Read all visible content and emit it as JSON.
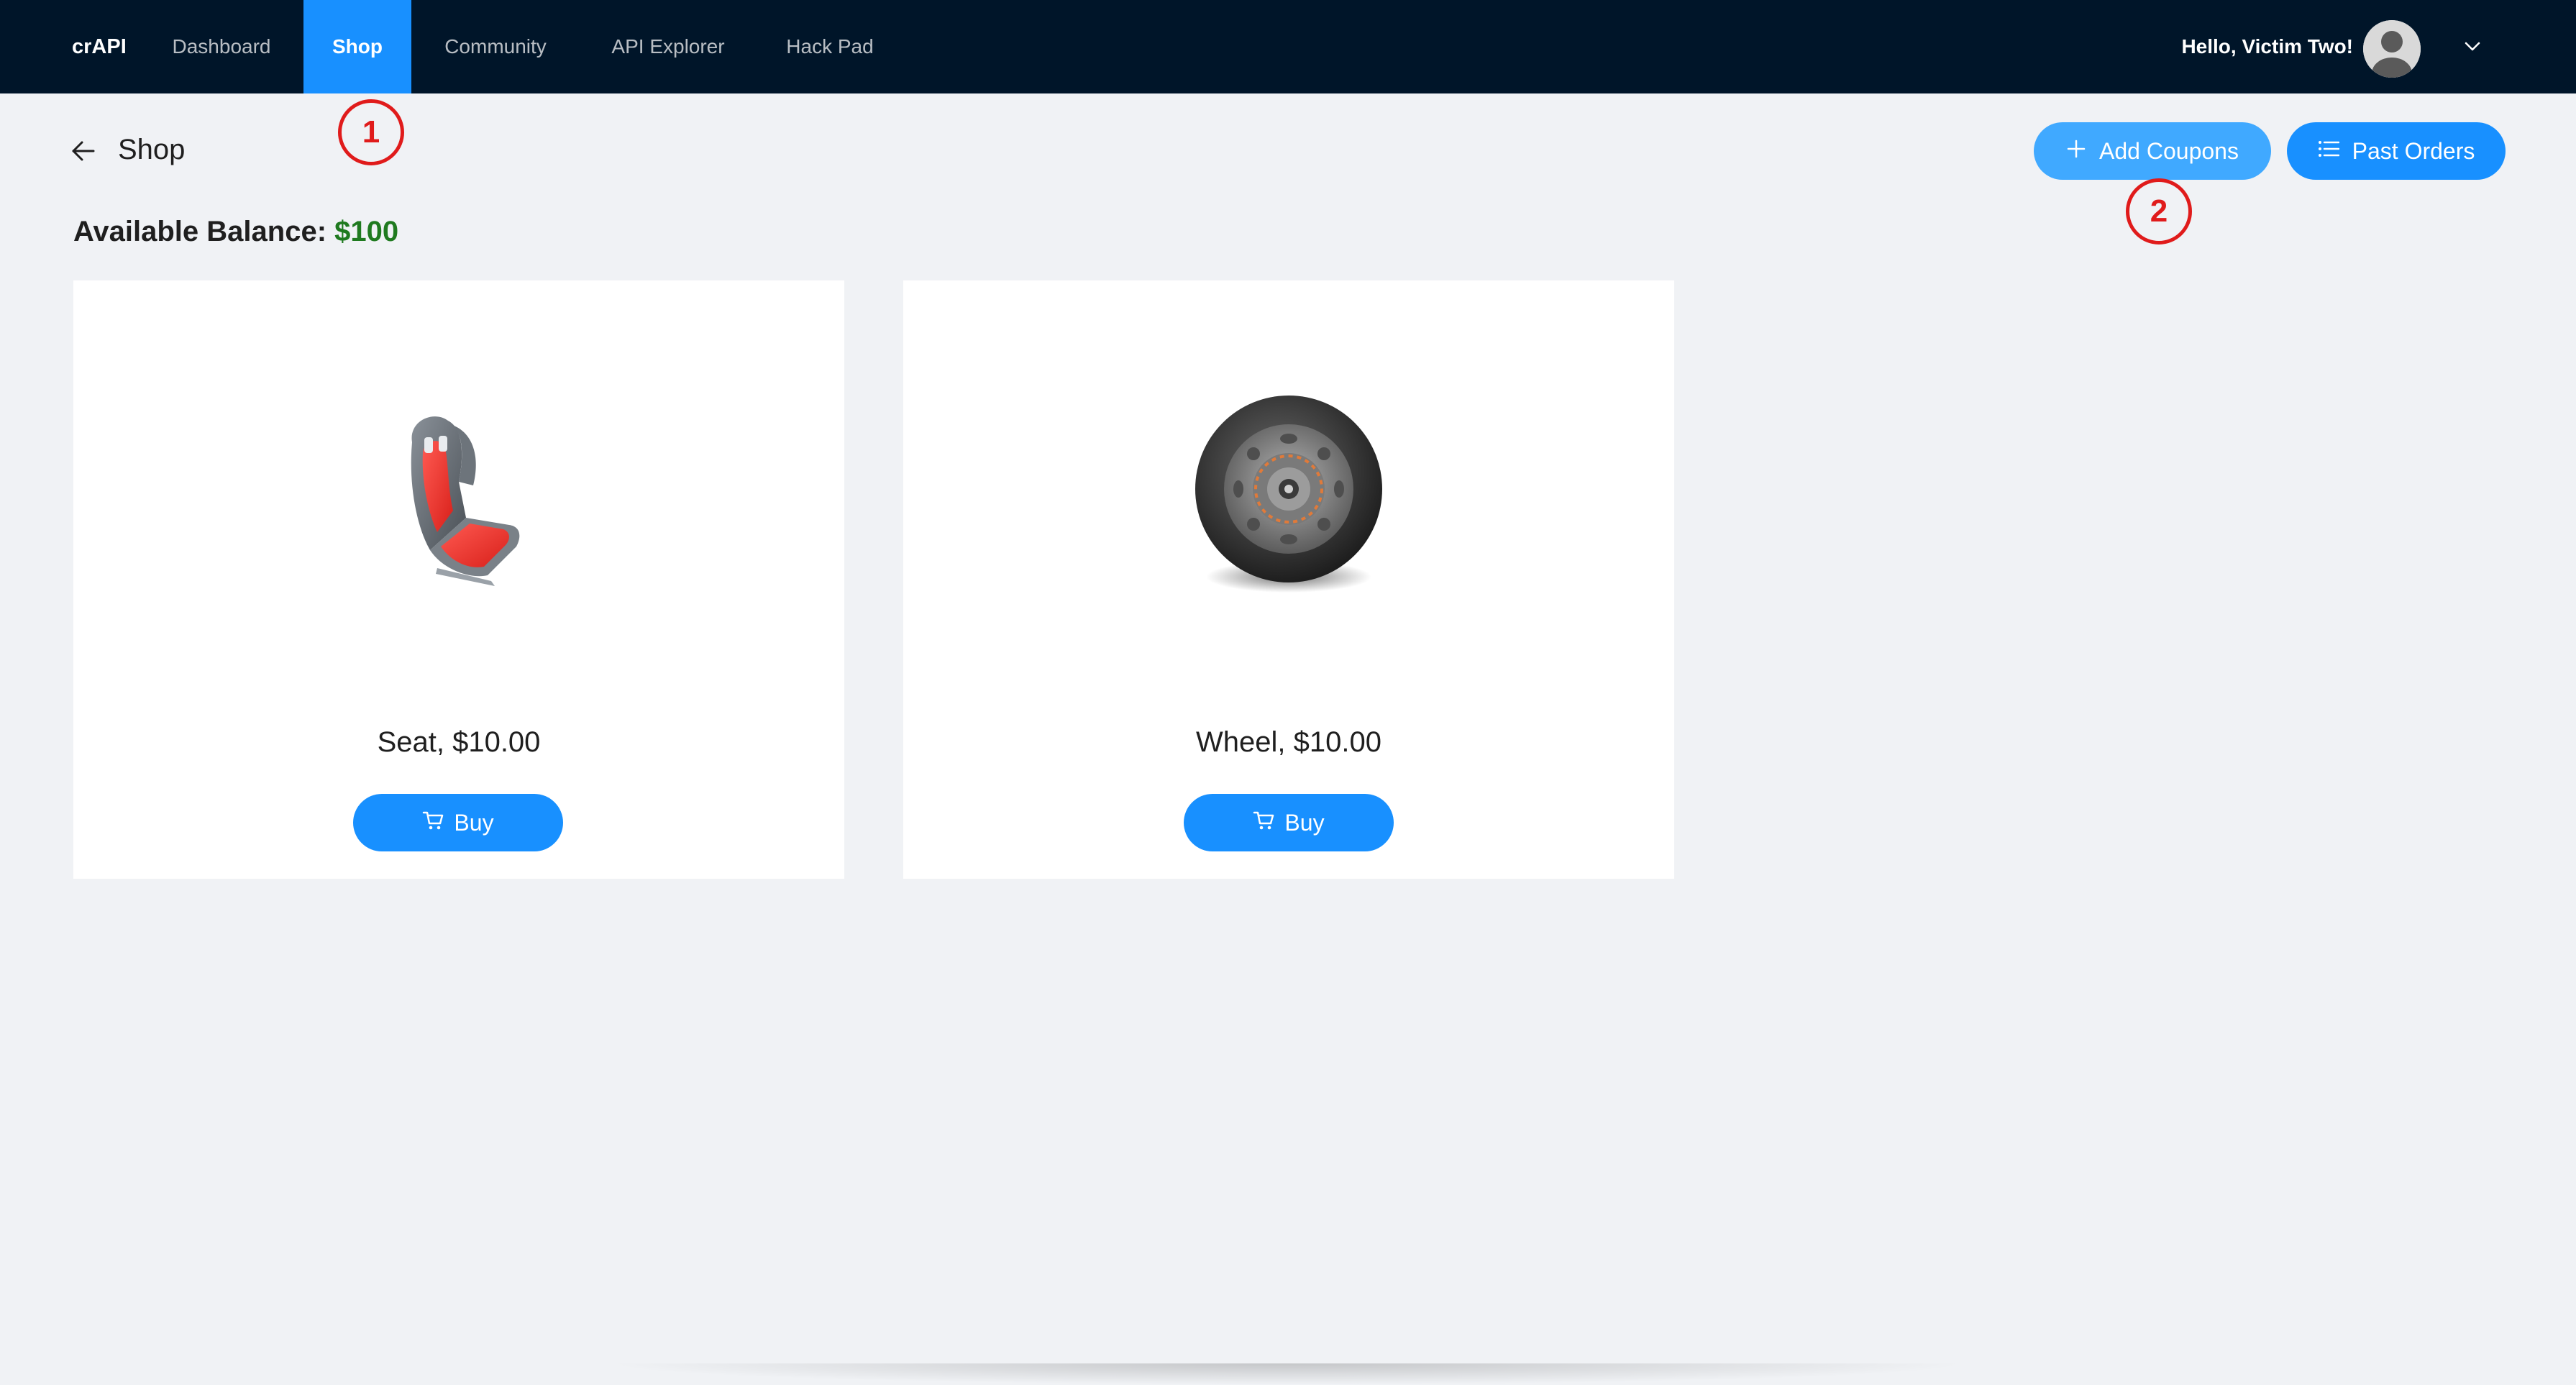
{
  "navbar": {
    "brand": "crAPI",
    "items": [
      {
        "label": "Dashboard"
      },
      {
        "label": "Shop"
      },
      {
        "label": "Community"
      },
      {
        "label": "API Explorer"
      },
      {
        "label": "Hack Pad"
      }
    ],
    "active_item": "Shop",
    "greeting": "Hello, Victim Two!",
    "background_color": "#001529",
    "active_color": "#1890ff"
  },
  "page": {
    "title": "Shop",
    "balance_label": "Available Balance",
    "balance_separator": ":",
    "balance_value": "$100",
    "balance_color": "#1f7a1f"
  },
  "actions": {
    "add_coupons_label": "Add Coupons",
    "past_orders_label": "Past Orders"
  },
  "annotations": [
    {
      "label": "1"
    },
    {
      "label": "2"
    }
  ],
  "products": [
    {
      "title": "Seat, $10.00",
      "buy_label": "Buy",
      "image": "car-seat-image"
    },
    {
      "title": "Wheel, $10.00",
      "buy_label": "Buy",
      "image": "wheel-image"
    }
  ],
  "icons": {
    "back": "arrow-left-icon",
    "add": "plus-icon",
    "orders": "list-icon",
    "cart": "shopping-cart-icon",
    "caret": "chevron-down-icon",
    "avatar": "user-avatar-icon"
  }
}
